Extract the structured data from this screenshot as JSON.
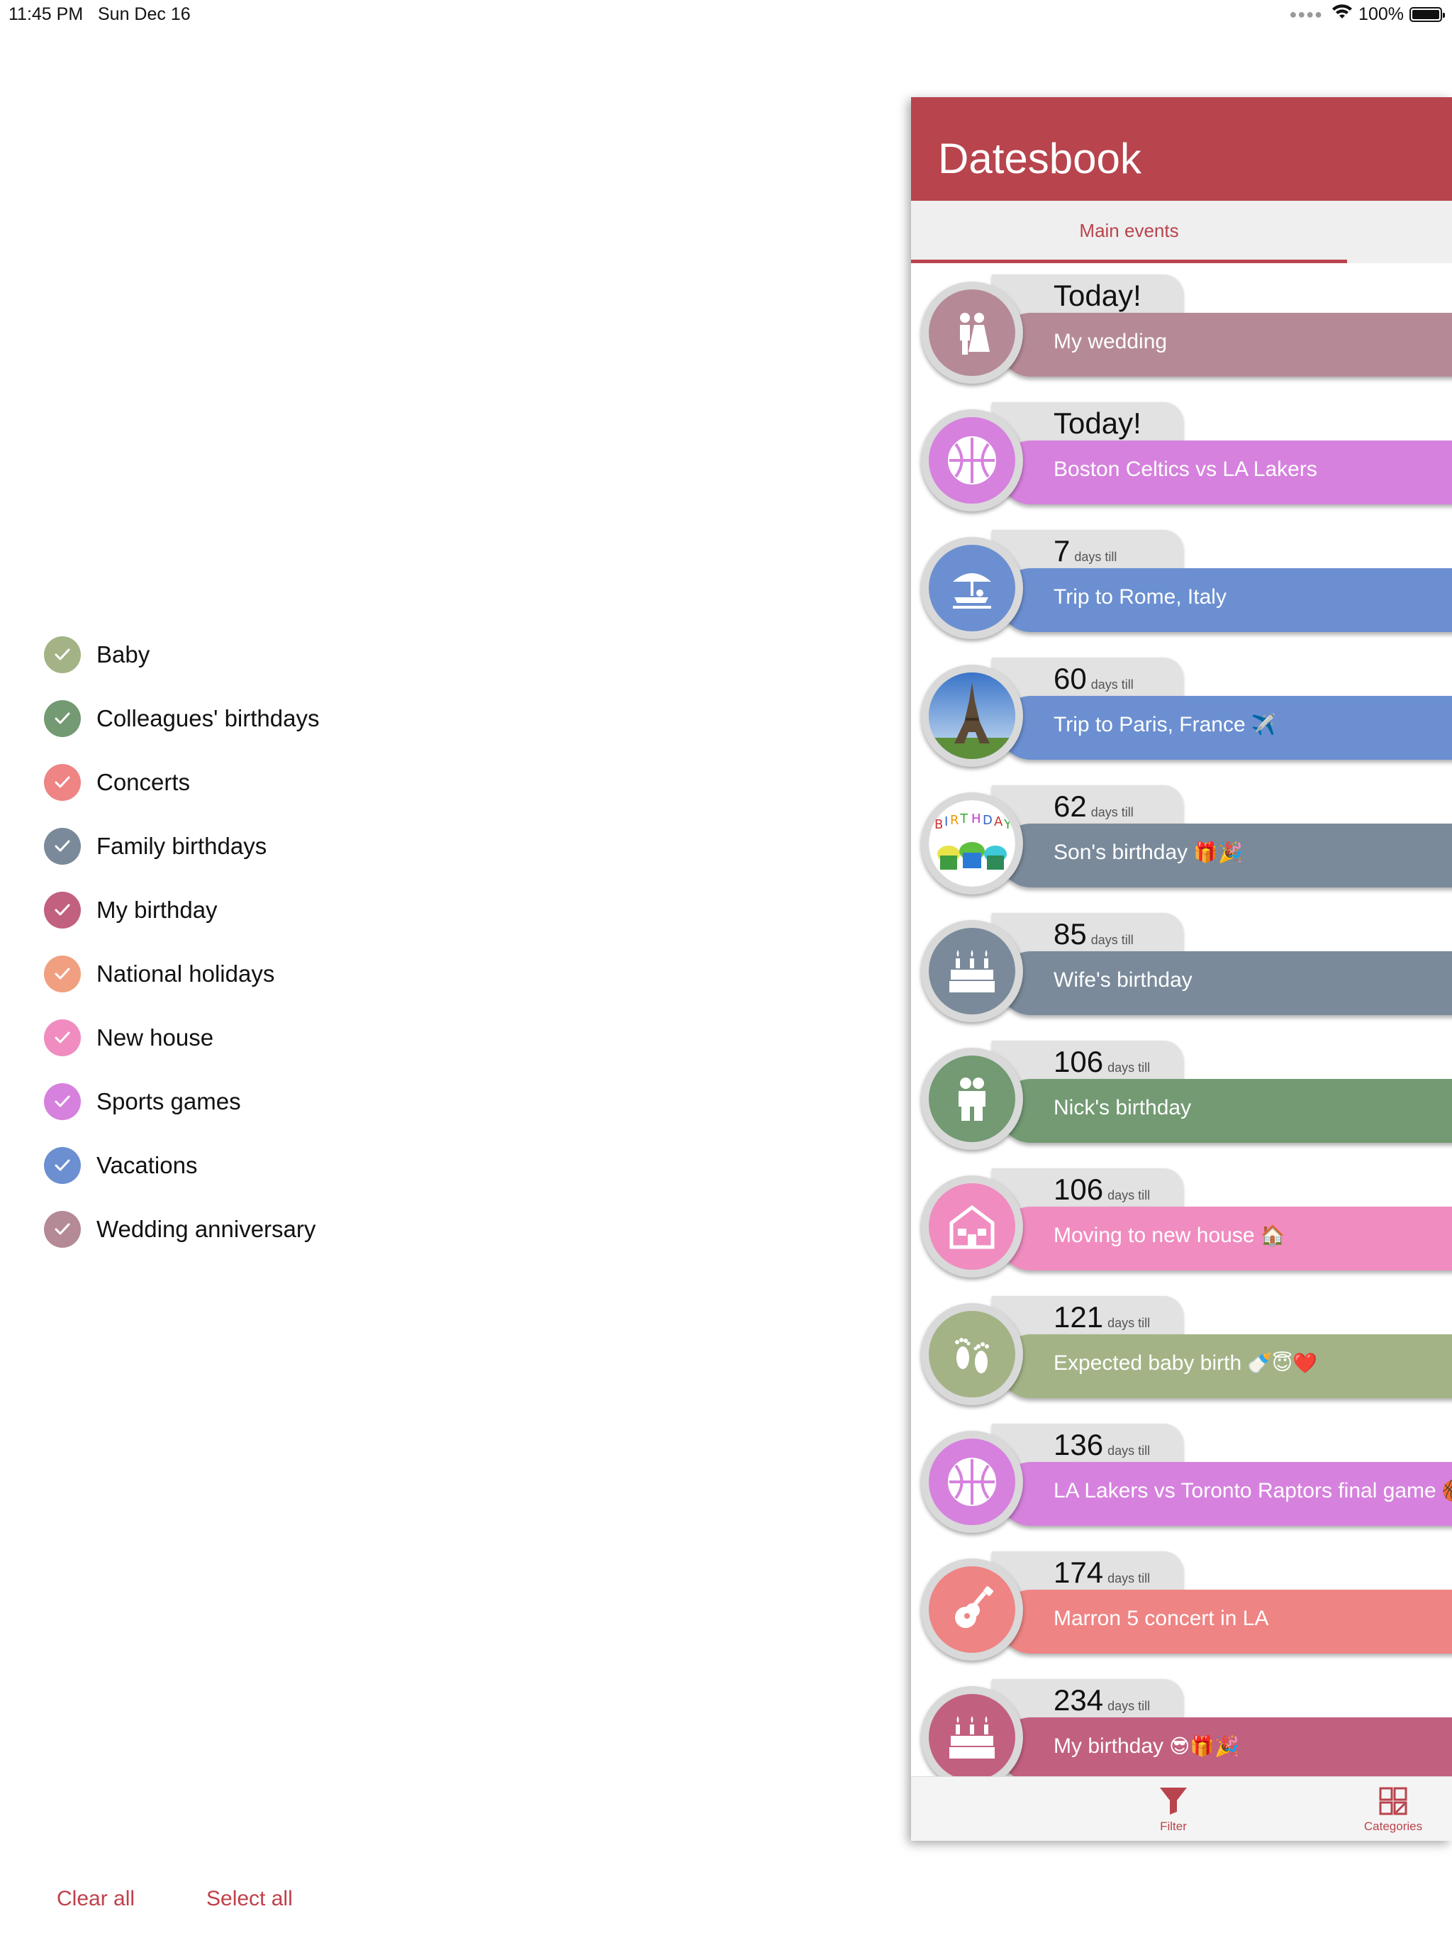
{
  "status_bar": {
    "time": "11:45 PM",
    "date": "Sun Dec 16",
    "battery": "100%"
  },
  "categories": [
    {
      "label": "Baby",
      "color": "#a3b386"
    },
    {
      "label": "Colleagues' birthdays",
      "color": "#739a73"
    },
    {
      "label": "Concerts",
      "color": "#ee8484"
    },
    {
      "label": "Family birthdays",
      "color": "#7a8a9a"
    },
    {
      "label": "My birthday",
      "color": "#c2607f"
    },
    {
      "label": "National holidays",
      "color": "#f0a080"
    },
    {
      "label": "New house",
      "color": "#f08cc0"
    },
    {
      "label": "Sports games",
      "color": "#d681de"
    },
    {
      "label": "Vacations",
      "color": "#6b8fd1"
    },
    {
      "label": "Wedding anniversary",
      "color": "#b48a96"
    }
  ],
  "footer": {
    "clear_all": "Clear all",
    "select_all": "Select all"
  },
  "app": {
    "title": "Datesbook",
    "tab_main": "Main events",
    "bottom_nav": {
      "filter": "Filter",
      "categories": "Categories"
    }
  },
  "events": [
    {
      "count": "Today!",
      "unit": "",
      "title": "My wedding",
      "emoji": "",
      "color": "#b58a96",
      "icon": "wedding-couple-icon"
    },
    {
      "count": "Today!",
      "unit": "",
      "title": "Boston Celtics vs LA Lakers",
      "emoji": "",
      "color": "#d681de",
      "icon": "basketball-icon"
    },
    {
      "count": "7",
      "unit": "days till",
      "title": "Trip to Rome, Italy",
      "emoji": "",
      "color": "#6b8fd1",
      "icon": "beach-umbrella-icon"
    },
    {
      "count": "60",
      "unit": "days till",
      "title": "Trip to Paris, France",
      "emoji": "✈️",
      "color": "#6b8fd1",
      "icon": "eiffel-tower-photo"
    },
    {
      "count": "62",
      "unit": "days till",
      "title": "Son's birthday",
      "emoji": "🎁🎉",
      "color": "#7a8a9a",
      "icon": "birthday-cupcakes-photo"
    },
    {
      "count": "85",
      "unit": "days till",
      "title": "Wife's birthday",
      "emoji": "",
      "color": "#7a8a9a",
      "icon": "birthday-cake-icon"
    },
    {
      "count": "106",
      "unit": "days till",
      "title": "Nick's birthday",
      "emoji": "",
      "color": "#739a73",
      "icon": "friends-icon"
    },
    {
      "count": "106",
      "unit": "days till",
      "title": "Moving to new house",
      "emoji": "🏠",
      "color": "#f08cc0",
      "icon": "house-icon"
    },
    {
      "count": "121",
      "unit": "days till",
      "title": "Expected baby birth",
      "emoji": "🍼😇❤️",
      "color": "#a3b386",
      "icon": "baby-feet-icon"
    },
    {
      "count": "136",
      "unit": "days till",
      "title": "LA Lakers vs Toronto Raptors final game",
      "emoji": "🏀",
      "color": "#d681de",
      "icon": "basketball-icon"
    },
    {
      "count": "174",
      "unit": "days till",
      "title": "Marron 5 concert in LA",
      "emoji": "",
      "color": "#ee8484",
      "icon": "guitar-icon"
    },
    {
      "count": "234",
      "unit": "days till",
      "title": "My birthday",
      "emoji": "😎🎁🎉",
      "color": "#c2607f",
      "icon": "birthday-cake-icon"
    }
  ]
}
